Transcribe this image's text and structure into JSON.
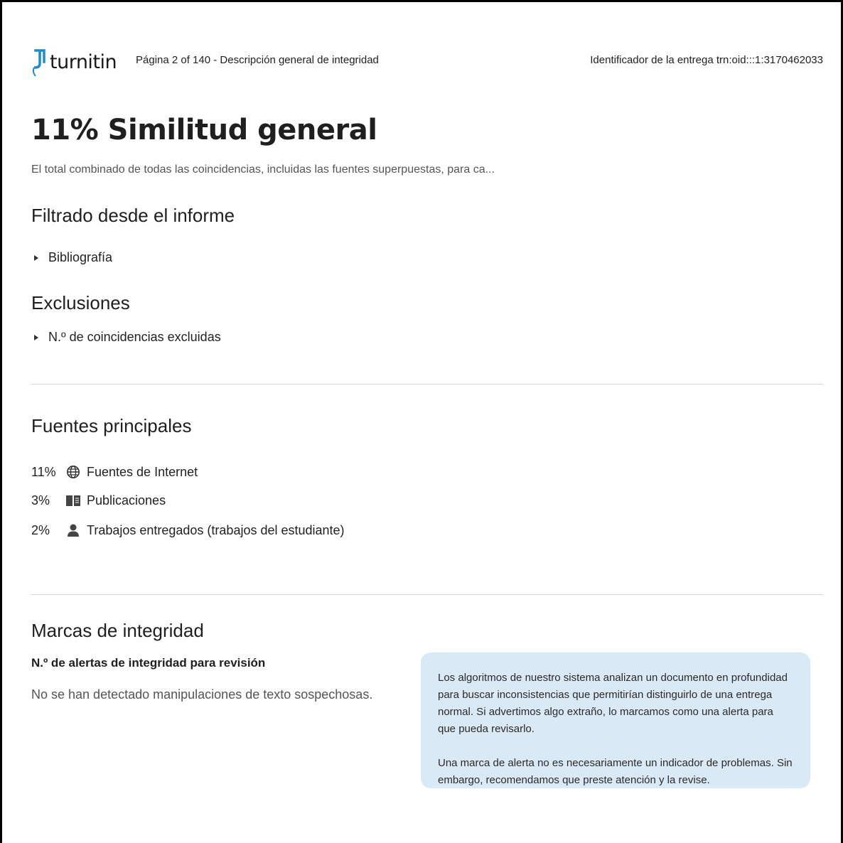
{
  "header": {
    "logo_text": "turnitin",
    "page_info": "Página 2 of 140 - Descripción general de integridad",
    "submission_id": "Identificador de la entrega trn:oid:::1:3170462033"
  },
  "summary": {
    "title": "11% Similitud general",
    "subtitle": "El total combinado de todas las coincidencias, incluidas las fuentes superpuestas, para ca..."
  },
  "filtered": {
    "heading": "Filtrado desde el informe",
    "items": [
      {
        "label": "Bibliografía"
      }
    ]
  },
  "exclusions": {
    "heading": "Exclusiones",
    "items": [
      {
        "label": "N.º de coincidencias excluidas"
      }
    ]
  },
  "top_sources": {
    "heading": "Fuentes principales",
    "rows": [
      {
        "percent": "11%",
        "icon": "globe-icon",
        "label": "Fuentes de Internet"
      },
      {
        "percent": "3%",
        "icon": "book-icon",
        "label": "Publicaciones"
      },
      {
        "percent": "2%",
        "icon": "person-icon",
        "label": "Trabajos entregados (trabajos del estudiante)"
      }
    ]
  },
  "integrity": {
    "heading": "Marcas de integridad",
    "alerts_label": "N.º de alertas de integridad para revisión",
    "no_alerts_text": "No se han detectado manipulaciones de texto sospechosas.",
    "info_paragraphs": [
      "Los algoritmos de nuestro sistema analizan un documento en profundidad para buscar inconsistencias que permitirían distinguirlo de una entrega normal. Si advertimos algo extraño, lo marcamos como una alerta para que pueda revisarlo.",
      "Una marca de alerta no es necesariamente un indicador de problemas. Sin embargo, recomendamos que preste atención y la revise."
    ]
  },
  "colors": {
    "brand_blue": "#1b8ec9",
    "info_box_bg": "#d9e9f6",
    "divider": "#d4d4d4"
  }
}
